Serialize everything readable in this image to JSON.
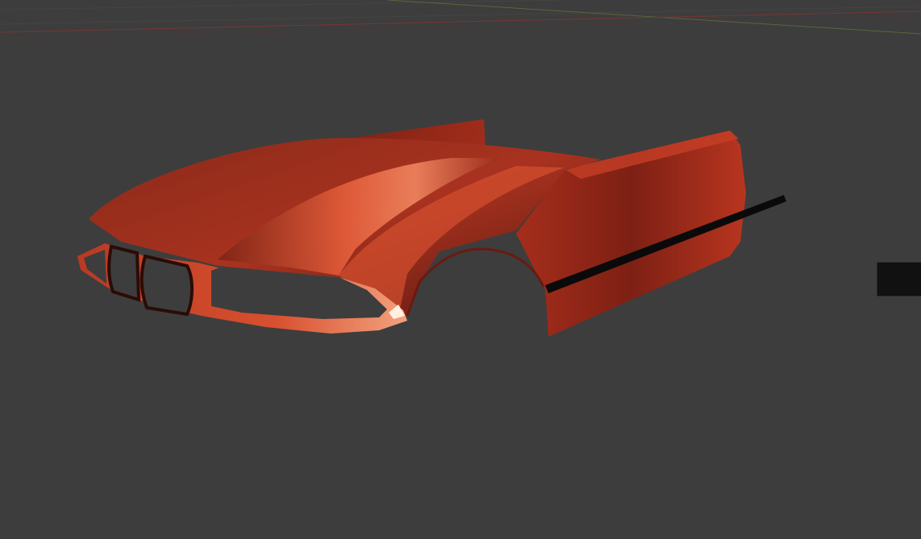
{
  "viewport": {
    "background": "#3d3d3d",
    "grid_colors": {
      "x_axis": "#8a3b3b",
      "y_axis": "#5b7a3a",
      "grid": "#444444"
    }
  },
  "model": {
    "paint_base": "#b8301d",
    "paint_shadow": "#4a120b",
    "paint_highlight": "#f07a55",
    "trim": "#0a0a0a"
  },
  "cursor": {
    "icon": "3d-cursor-icon",
    "ring_colors": [
      "#e04040",
      "#ffffff"
    ],
    "center_color": "#f0a030"
  }
}
